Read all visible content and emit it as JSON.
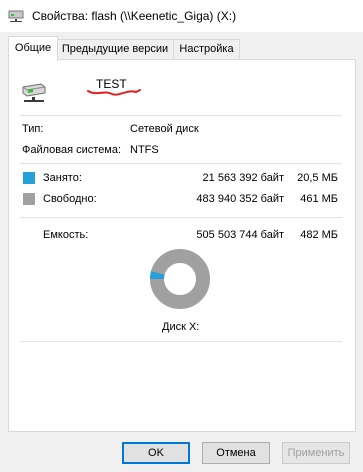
{
  "window": {
    "title": "Свойства: flash (\\\\Keenetic_Giga) (X:)"
  },
  "tabs": [
    {
      "label": "Общие",
      "active": true
    },
    {
      "label": "Предыдущие версии",
      "active": false
    },
    {
      "label": "Настройка",
      "active": false
    }
  ],
  "general": {
    "name": "TEST",
    "type_label": "Тип:",
    "type_value": "Сетевой диск",
    "fs_label": "Файловая система:",
    "fs_value": "NTFS",
    "used": {
      "label": "Занято:",
      "bytes": "21 563 392 байт",
      "human": "20,5 МБ",
      "color": "#26a0da"
    },
    "free": {
      "label": "Свободно:",
      "bytes": "483 940 352 байт",
      "human": "461 МБ",
      "color": "#a0a0a0"
    },
    "capacity": {
      "label": "Емкость:",
      "bytes": "505 503 744 байт",
      "human": "482 МБ"
    },
    "drive_caption": "Диск X:",
    "used_fraction": 0.0427
  },
  "buttons": {
    "ok": "OK",
    "cancel": "Отмена",
    "apply": "Применить"
  },
  "colors": {
    "accent": "#0078d7",
    "used": "#26a0da",
    "free": "#a0a0a0",
    "scribble": "#e02020"
  }
}
